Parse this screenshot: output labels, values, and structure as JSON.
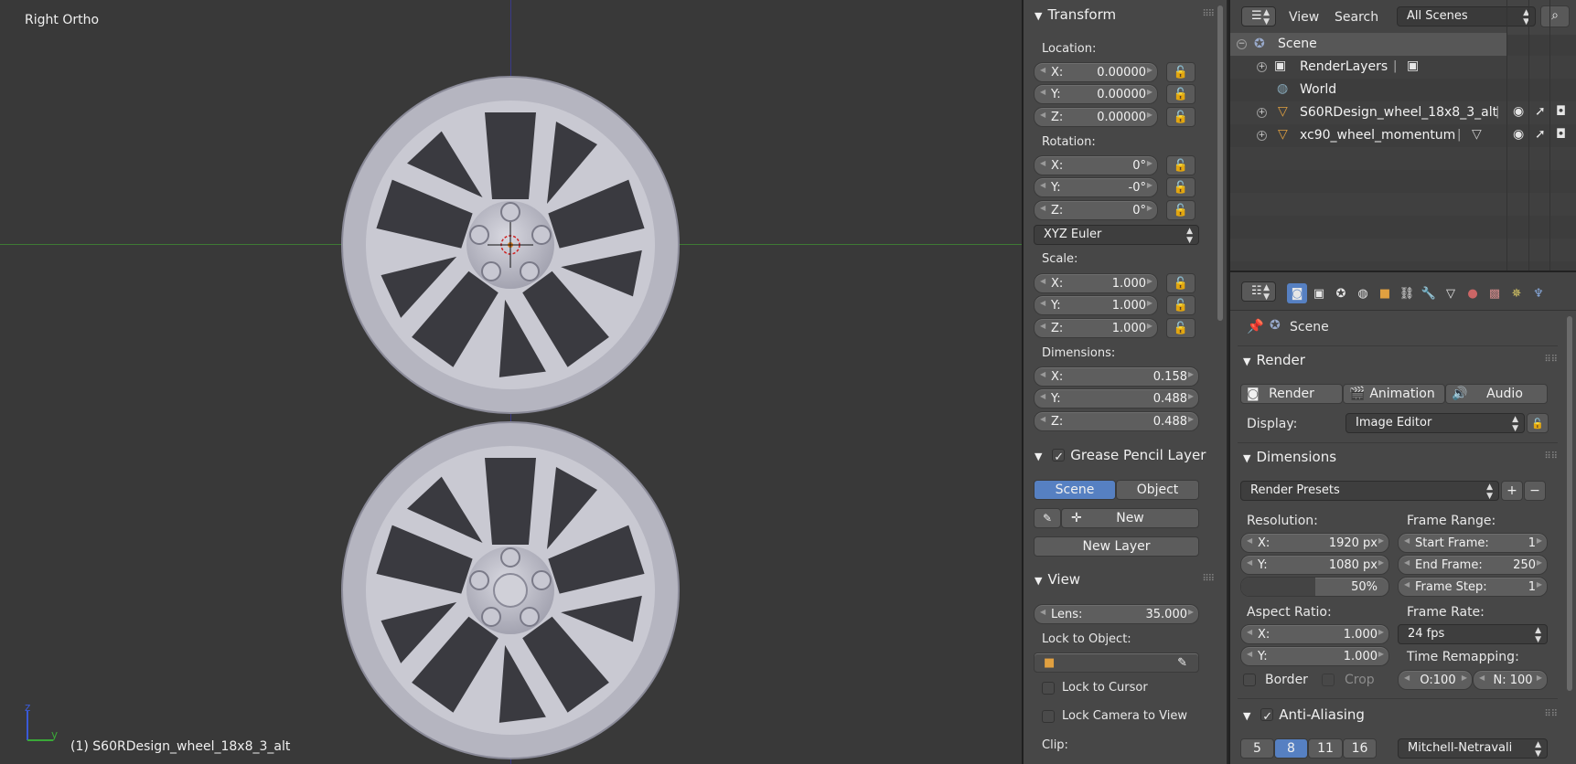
{
  "viewport": {
    "title": "Right Ortho",
    "footer": "(1) S60RDesign_wheel_18x8_3_alt",
    "gizmo": {
      "z": "z",
      "y": "y"
    }
  },
  "transform": {
    "header": "Transform",
    "location_label": "Location:",
    "location": [
      {
        "k": "X:",
        "v": "0.00000"
      },
      {
        "k": "Y:",
        "v": "0.00000"
      },
      {
        "k": "Z:",
        "v": "0.00000"
      }
    ],
    "rotation_label": "Rotation:",
    "rotation": [
      {
        "k": "X:",
        "v": "0°"
      },
      {
        "k": "Y:",
        "v": "-0°"
      },
      {
        "k": "Z:",
        "v": "0°"
      }
    ],
    "rotation_mode": "XYZ Euler",
    "scale_label": "Scale:",
    "scale": [
      {
        "k": "X:",
        "v": "1.000"
      },
      {
        "k": "Y:",
        "v": "1.000"
      },
      {
        "k": "Z:",
        "v": "1.000"
      }
    ],
    "dimensions_label": "Dimensions:",
    "dimensions": [
      {
        "k": "X:",
        "v": "0.158"
      },
      {
        "k": "Y:",
        "v": "0.488"
      },
      {
        "k": "Z:",
        "v": "0.488"
      }
    ]
  },
  "grease": {
    "header": "Grease Pencil Layer",
    "scene": "Scene",
    "object": "Object",
    "new": "New",
    "new_layer": "New Layer"
  },
  "view": {
    "header": "View",
    "lens_k": "Lens:",
    "lens_v": "35.000",
    "lock_object": "Lock to Object:",
    "lock_cursor": "Lock to Cursor",
    "lock_camera": "Lock Camera to View",
    "clip": "Clip:"
  },
  "outliner": {
    "view": "View",
    "search": "Search",
    "scope": "All Scenes",
    "rows": [
      {
        "name": "Scene"
      },
      {
        "name": "RenderLayers"
      },
      {
        "name": "World"
      },
      {
        "name": "S60RDesign_wheel_18x8_3_alt"
      },
      {
        "name": "xc90_wheel_momentum"
      }
    ]
  },
  "properties": {
    "context": "Scene",
    "render": {
      "header": "Render",
      "render_btn": "Render",
      "animation_btn": "Animation",
      "audio_btn": "Audio",
      "display_label": "Display:",
      "display_value": "Image Editor"
    },
    "dimensions": {
      "header": "Dimensions",
      "presets": "Render Presets",
      "resolution_label": "Resolution:",
      "res_x_k": "X:",
      "res_x_v": "1920 px",
      "res_y_k": "Y:",
      "res_y_v": "1080 px",
      "res_pct": "50%",
      "res_pct_fraction": 0.5,
      "frame_range_label": "Frame Range:",
      "start_k": "Start Frame:",
      "start_v": "1",
      "end_k": "End Frame:",
      "end_v": "250",
      "step_k": "Frame Step:",
      "step_v": "1",
      "aspect_label": "Aspect Ratio:",
      "asp_x_k": "X:",
      "asp_x_v": "1.000",
      "asp_y_k": "Y:",
      "asp_y_v": "1.000",
      "frame_rate_label": "Frame Rate:",
      "frame_rate": "24 fps",
      "time_remap_label": "Time Remapping:",
      "remap_old": "O:100",
      "remap_new": "N: 100",
      "border": "Border",
      "crop": "Crop"
    },
    "aa": {
      "header": "Anti-Aliasing",
      "samples": [
        "5",
        "8",
        "11",
        "16"
      ],
      "filter": "Mitchell-Netravali"
    }
  }
}
